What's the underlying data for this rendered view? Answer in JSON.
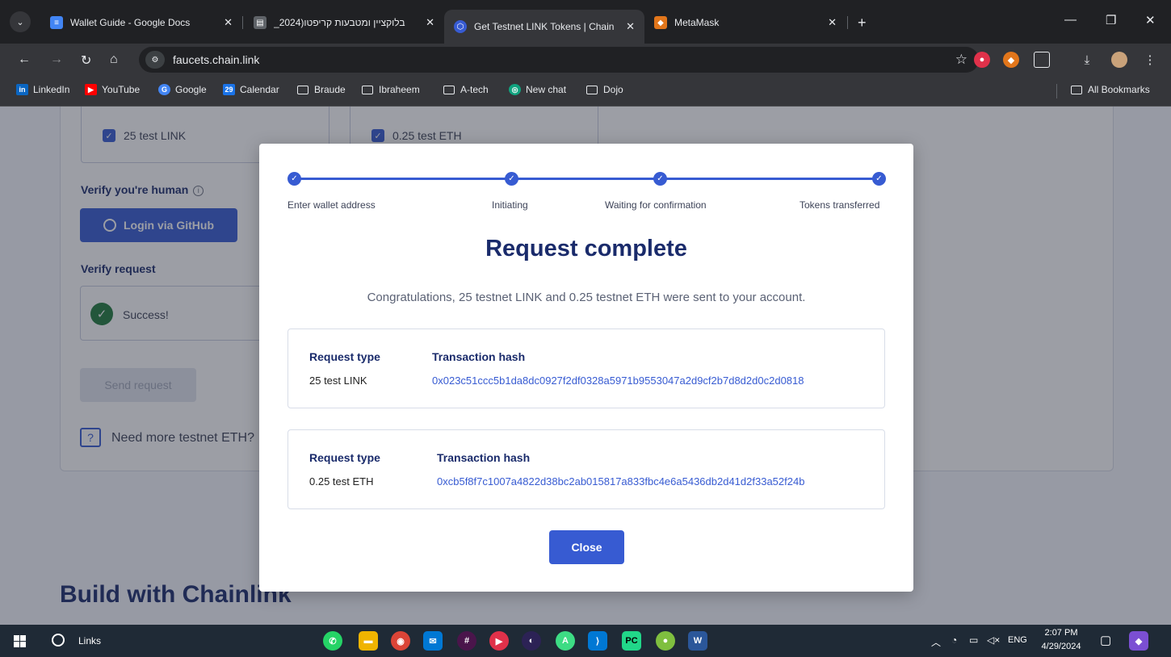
{
  "browser": {
    "tabs": [
      {
        "title": "Wallet Guide - Google Docs",
        "icon": "google-docs-icon",
        "color": "#4285f4"
      },
      {
        "title": "בלוקציין ומטבעות קריפטו(2024_",
        "icon": "document-icon",
        "color": "#5f6368"
      },
      {
        "title": "Get Testnet LINK Tokens | Chain",
        "icon": "chainlink-icon",
        "color": "#375bd2"
      },
      {
        "title": "MetaMask",
        "icon": "metamask-icon",
        "color": "#e2761b"
      }
    ],
    "url": "faucets.chain.link",
    "bookmarks": [
      {
        "label": "LinkedIn",
        "icon": "linkedin-icon",
        "color": "#0a66c2",
        "glyph": "in"
      },
      {
        "label": "YouTube",
        "icon": "youtube-icon",
        "color": "#ff0000",
        "glyph": "▶"
      },
      {
        "label": "Google",
        "icon": "google-icon",
        "color": "#4285f4",
        "glyph": "G"
      },
      {
        "label": "Calendar",
        "icon": "calendar-icon",
        "color": "#1a73e8",
        "glyph": "29"
      },
      {
        "label": "Braude",
        "icon": "folder-icon"
      },
      {
        "label": "Ibraheem",
        "icon": "folder-icon"
      },
      {
        "label": "A-tech",
        "icon": "folder-icon"
      },
      {
        "label": "New chat",
        "icon": "chatgpt-icon",
        "color": "#10a37f",
        "glyph": "◎"
      },
      {
        "label": "Dojo",
        "icon": "folder-icon"
      }
    ],
    "all_bookmarks": "All Bookmarks"
  },
  "page": {
    "options": [
      {
        "label": "25 test LINK",
        "checked": true
      },
      {
        "label": "0.25 test ETH",
        "checked": true
      }
    ],
    "verify_human": "Verify you're human",
    "github_button": "Login via GitHub",
    "verify_request": "Verify request",
    "success": "Success!",
    "send_request": "Send request",
    "need_more": "Need more testnet ETH?",
    "build_heading": "Build with Chainlink"
  },
  "modal": {
    "steps": [
      {
        "label": "Enter wallet address"
      },
      {
        "label": "Initiating"
      },
      {
        "label": "Waiting for confirmation"
      },
      {
        "label": "Tokens transferred"
      }
    ],
    "title": "Request complete",
    "message": "Congratulations, 25 testnet LINK and 0.25 testnet ETH were sent to your account.",
    "transactions": [
      {
        "type_header": "Request type",
        "hash_header": "Transaction hash",
        "type": "25 test LINK",
        "hash": "0x023c51ccc5b1da8dc0927f2df0328a5971b9553047a2d9cf2b7d8d2d0c2d0818"
      },
      {
        "type_header": "Request type",
        "hash_header": "Transaction hash",
        "type": "0.25 test ETH",
        "hash": "0xcb5f8f7c1007a4822d38bc2ab015817a833fbc4e6a5436db2d41d2f33a52f24b"
      }
    ],
    "close": "Close"
  },
  "taskbar": {
    "search": "Links",
    "language": "ENG",
    "time": "2:07 PM",
    "date": "4/29/2024"
  }
}
